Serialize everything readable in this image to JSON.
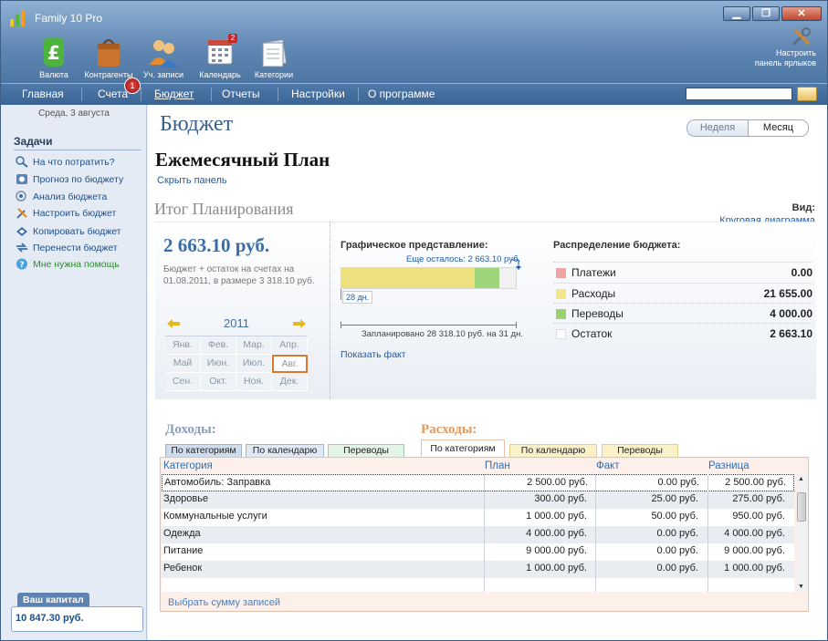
{
  "window": {
    "title": "Family 10 Pro"
  },
  "toolbar": {
    "items": [
      {
        "label": "Валюта",
        "icon": "currency-icon"
      },
      {
        "label": "Контрагенты",
        "icon": "bag-icon"
      },
      {
        "label": "Уч. записи",
        "icon": "users-icon"
      },
      {
        "label": "Календарь",
        "icon": "calendar-icon",
        "badge": "2"
      },
      {
        "label": "Категории",
        "icon": "categories-icon"
      }
    ],
    "config_line1": "Настроить",
    "config_line2": "панель ярлыков"
  },
  "nav": {
    "items": [
      "Главная",
      "Счета",
      "Бюджет",
      "Отчеты",
      "Настройки",
      "О программе"
    ],
    "active": "Бюджет",
    "badge": "1",
    "search_value": ""
  },
  "sidebar": {
    "date": "Среда, 3 августа",
    "tasks_title": "Задачи",
    "tasks": [
      "На что потратить?",
      "Прогноз по бюджету",
      "Анализ бюджета",
      "Настроить бюджет",
      "Копировать бюджет",
      "Перенести бюджет",
      "Мне нужна помощь"
    ],
    "capital_label": "Ваш капитал",
    "capital_value": "10 847.30 руб."
  },
  "main": {
    "title": "Бюджет",
    "period": {
      "week": "Неделя",
      "month": "Месяц",
      "selected": "Месяц"
    },
    "plan_title": "Ежемесячный План",
    "hide_panel": "Скрыть панель",
    "view_label": "Вид:",
    "view_value": "Круговая диаграмма",
    "summary": {
      "title": "Итог Планирования",
      "amount": "2 663.10 руб.",
      "note": "Бюджет + остаток на счетах на 01.08.2011, в размере 3 318.10 руб."
    },
    "calendar": {
      "year": "2011",
      "months": [
        "Янв.",
        "Фев.",
        "Мар.",
        "Апр.",
        "Май",
        "Июн.",
        "Июл.",
        "Авг.",
        "Сен.",
        "Окт.",
        "Ноя.",
        "Дек."
      ],
      "selected": "Авг."
    },
    "graph": {
      "title": "Графическое представление:",
      "remain_note": "Еще осталось: 2 663.10 руб.",
      "day_badge": "28 дн.",
      "planned_note": "Запланировано 28 318.10 руб. на 31 дн.",
      "show_fact": "Показать факт",
      "segments": [
        {
          "name": "Расходы",
          "value": 21655.0,
          "color": "#ece17e"
        },
        {
          "name": "Переводы",
          "value": 4000.0,
          "color": "#9fd57a"
        },
        {
          "name": "Остаток",
          "value": 2663.1,
          "color": "#f1f1f1"
        }
      ],
      "total": 28318.1
    },
    "distribution": {
      "title": "Распределение бюджета:",
      "rows": [
        {
          "name": "Платежи",
          "value": "0.00",
          "color": "#f2a3a3"
        },
        {
          "name": "Расходы",
          "value": "21 655.00",
          "color": "#f2e58a"
        },
        {
          "name": "Переводы",
          "value": "4 000.00",
          "color": "#9ad26f"
        },
        {
          "name": "Остаток",
          "value": "2 663.10",
          "color": "#ffffff"
        }
      ]
    }
  },
  "income": {
    "title": "Доходы:",
    "tabs": [
      "По категориям",
      "По календарю",
      "Переводы"
    ]
  },
  "expenses": {
    "title": "Расходы:",
    "tabs": [
      "По категориям",
      "По календарю",
      "Переводы"
    ],
    "columns": [
      "Категория",
      "План",
      "Факт",
      "Разница"
    ],
    "rows": [
      [
        "Автомобиль: Заправка",
        "2 500.00 руб.",
        "0.00 руб.",
        "2 500.00 руб."
      ],
      [
        "Здоровье",
        "300.00 руб.",
        "25.00 руб.",
        "275.00 руб."
      ],
      [
        "Коммунальные услуги",
        "1 000.00 руб.",
        "50.00 руб.",
        "950.00 руб."
      ],
      [
        "Одежда",
        "4 000.00 руб.",
        "0.00 руб.",
        "4 000.00 руб."
      ],
      [
        "Питание",
        "9 000.00 руб.",
        "0.00 руб.",
        "9 000.00 руб."
      ],
      [
        "Ребенок",
        "1 000.00 руб.",
        "0.00 руб.",
        "1 000.00 руб."
      ]
    ],
    "sum_link": "Выбрать сумму записей"
  }
}
